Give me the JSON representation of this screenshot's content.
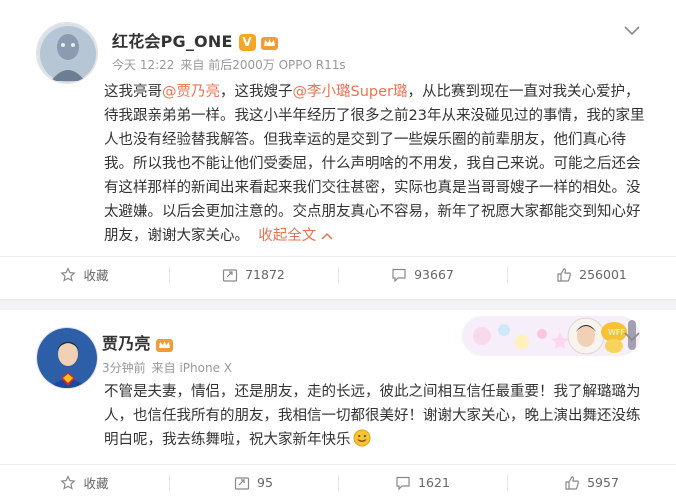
{
  "post1": {
    "user": {
      "name": "红花会PG_ONE",
      "badge": "V"
    },
    "meta": {
      "time": "今天 12:22",
      "source": "来自 前后2000万 OPPO R11s"
    },
    "content": {
      "t1": "这我亮哥",
      "m1": "@贾乃亮",
      "t2": "，这我嫂子",
      "m2": "@李小璐Super璐",
      "t3": "，从比赛到现在一直对我关心爱护，待我跟亲弟弟一样。我这小半年经历了很多之前23年从来没碰见过的事情，我的家里人也没有经验替我解答。但我幸运的是交到了一些娱乐圈的前辈朋友，他们真心待我。所以我也不能让他们受委屈，什么声明啥的不用发，我自己来说。可能之后还会有这样那样的新闻出来看起来我们交往甚密，实际也真是当哥哥嫂子一样的相处。没太避嫌。以后会更加注意的。交点朋友真心不容易，新年了祝愿大家都能交到知心好朋友，谢谢大家关心。",
      "collapse": "收起全文"
    },
    "actions": {
      "favorite": "收藏",
      "repost": "71872",
      "comment": "93667",
      "like": "256001"
    }
  },
  "post2": {
    "user": {
      "name": "贾乃亮",
      "badge": ""
    },
    "meta": {
      "time": "3分钟前",
      "source": "来自 iPhone X"
    },
    "content": {
      "text": "不管是夫妻，情侣，还是朋友，走的长远，彼此之间相互信任最重要！我了解璐璐为人，也信任我所有的朋友，我相信一切都很美好！谢谢大家关心，晚上演出舞还没练明白呢，我去练舞啦，祝大家新年快乐"
    },
    "actions": {
      "favorite": "收藏",
      "repost": "95",
      "comment": "1621",
      "like": "5957"
    }
  },
  "colors": {
    "mention": "#eb7350",
    "verified_badge": "#f5a623",
    "text": "#333333",
    "muted": "#999999"
  },
  "icons": [
    "avatar-image",
    "verified-v-icon",
    "member-crown-icon",
    "chevron-down-icon",
    "star-icon",
    "repost-icon",
    "comment-icon",
    "like-thumb-icon",
    "smile-emoji-icon",
    "sticker-banner"
  ]
}
